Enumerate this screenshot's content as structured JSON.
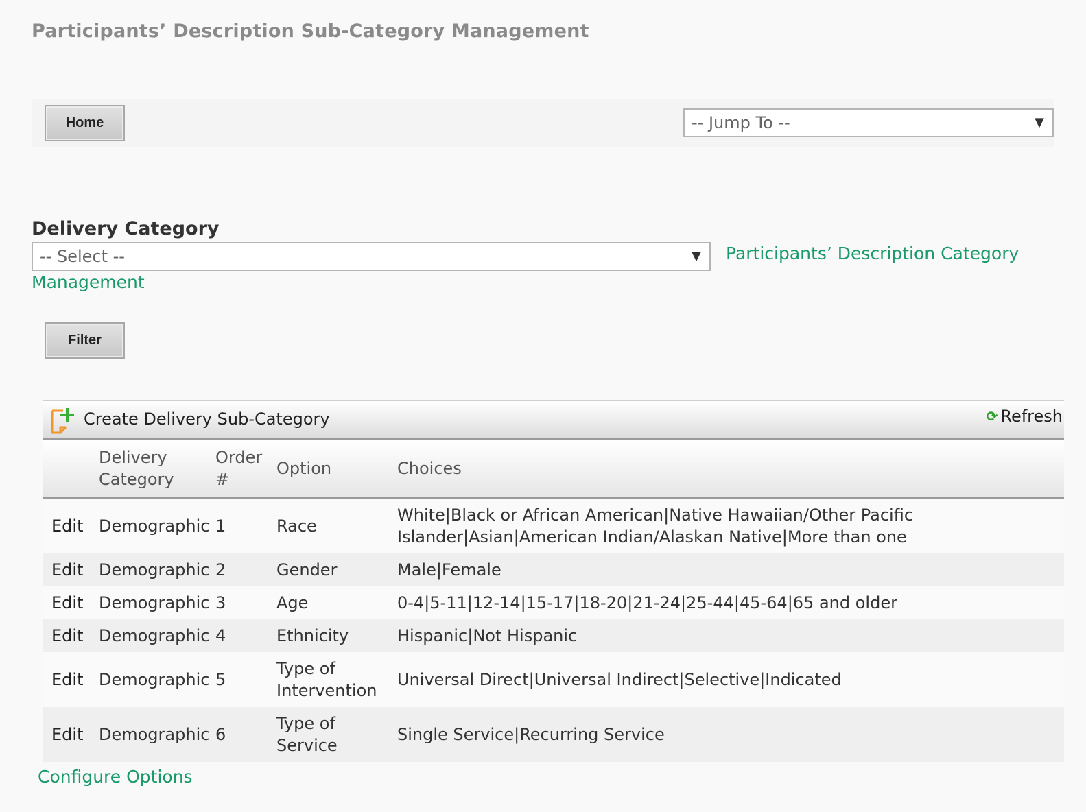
{
  "page_title": "Participants’ Description Sub-Category Management",
  "toolbar": {
    "home_label": "Home",
    "jump_to_value": "-- Jump To --"
  },
  "delivery_category": {
    "label": "Delivery Category",
    "select_value": "-- Select --",
    "link_line1": "Participants’ Description Category",
    "link_line2": "Management",
    "filter_label": "Filter"
  },
  "grid": {
    "create_label": "Create Delivery Sub-Category",
    "refresh_label": "Refresh",
    "headers": {
      "delivery_category_1": "Delivery",
      "delivery_category_2": "Category",
      "order_1": "Order",
      "order_2": "#",
      "option": "Option",
      "choices": "Choices"
    },
    "rows": [
      {
        "edit": "Edit",
        "category": "Demographic",
        "order": "1",
        "option": "Race",
        "choices": "White|Black or African American|Native Hawaiian/Other Pacific Islander|Asian|American Indian/Alaskan Native|More than one"
      },
      {
        "edit": "Edit",
        "category": "Demographic",
        "order": "2",
        "option": "Gender",
        "choices": "Male|Female"
      },
      {
        "edit": "Edit",
        "category": "Demographic",
        "order": "3",
        "option": "Age",
        "choices": "0-4|5-11|12-14|15-17|18-20|21-24|25-44|45-64|65 and older"
      },
      {
        "edit": "Edit",
        "category": "Demographic",
        "order": "4",
        "option": "Ethnicity",
        "choices": "Hispanic|Not Hispanic"
      },
      {
        "edit": "Edit",
        "category": "Demographic",
        "order": "5",
        "option": "Type of Intervention",
        "choices": "Universal Direct|Universal Indirect|Selective|Indicated"
      },
      {
        "edit": "Edit",
        "category": "Demographic",
        "order": "6",
        "option": "Type of Service",
        "choices": "Single Service|Recurring Service"
      }
    ]
  },
  "configure_label": "Configure Options",
  "icons": {
    "create": "add-document-icon",
    "refresh": "refresh-icon",
    "dropdown": "caret-down-icon"
  },
  "colors": {
    "link": "#1a9a6a",
    "title": "#8a8a8a",
    "refresh": "#2aa02a",
    "create_icon_orange": "#f0962a",
    "create_icon_green": "#38b038"
  }
}
